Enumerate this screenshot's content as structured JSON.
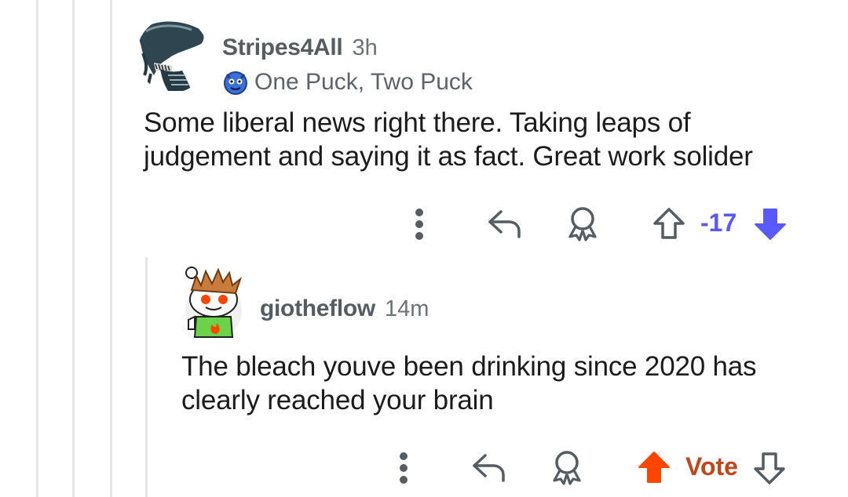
{
  "comments": [
    {
      "username": "Stripes4All",
      "time": "3h",
      "flair": "One Puck, Two Puck",
      "body_lines": [
        "Some liberal news right there. Taking leaps of",
        "judgement and saying it as fact. Great work solider"
      ],
      "score": "-17",
      "vote_state": "downvoted",
      "colors": {
        "downvote": "#5a58ff",
        "score": "#5a58ff"
      }
    },
    {
      "username": "giotheflow",
      "time": "14m",
      "body_lines": [
        "The bleach youve been drinking since 2020 has",
        "clearly reached your brain"
      ],
      "score": "Vote",
      "vote_state": "upvoted",
      "colors": {
        "upvote": "#ff4500",
        "score": "#c0461c"
      }
    }
  ],
  "icons": [
    "more-options-icon",
    "reply-icon",
    "award-icon",
    "upvote-icon",
    "downvote-icon",
    "flair-icon"
  ]
}
